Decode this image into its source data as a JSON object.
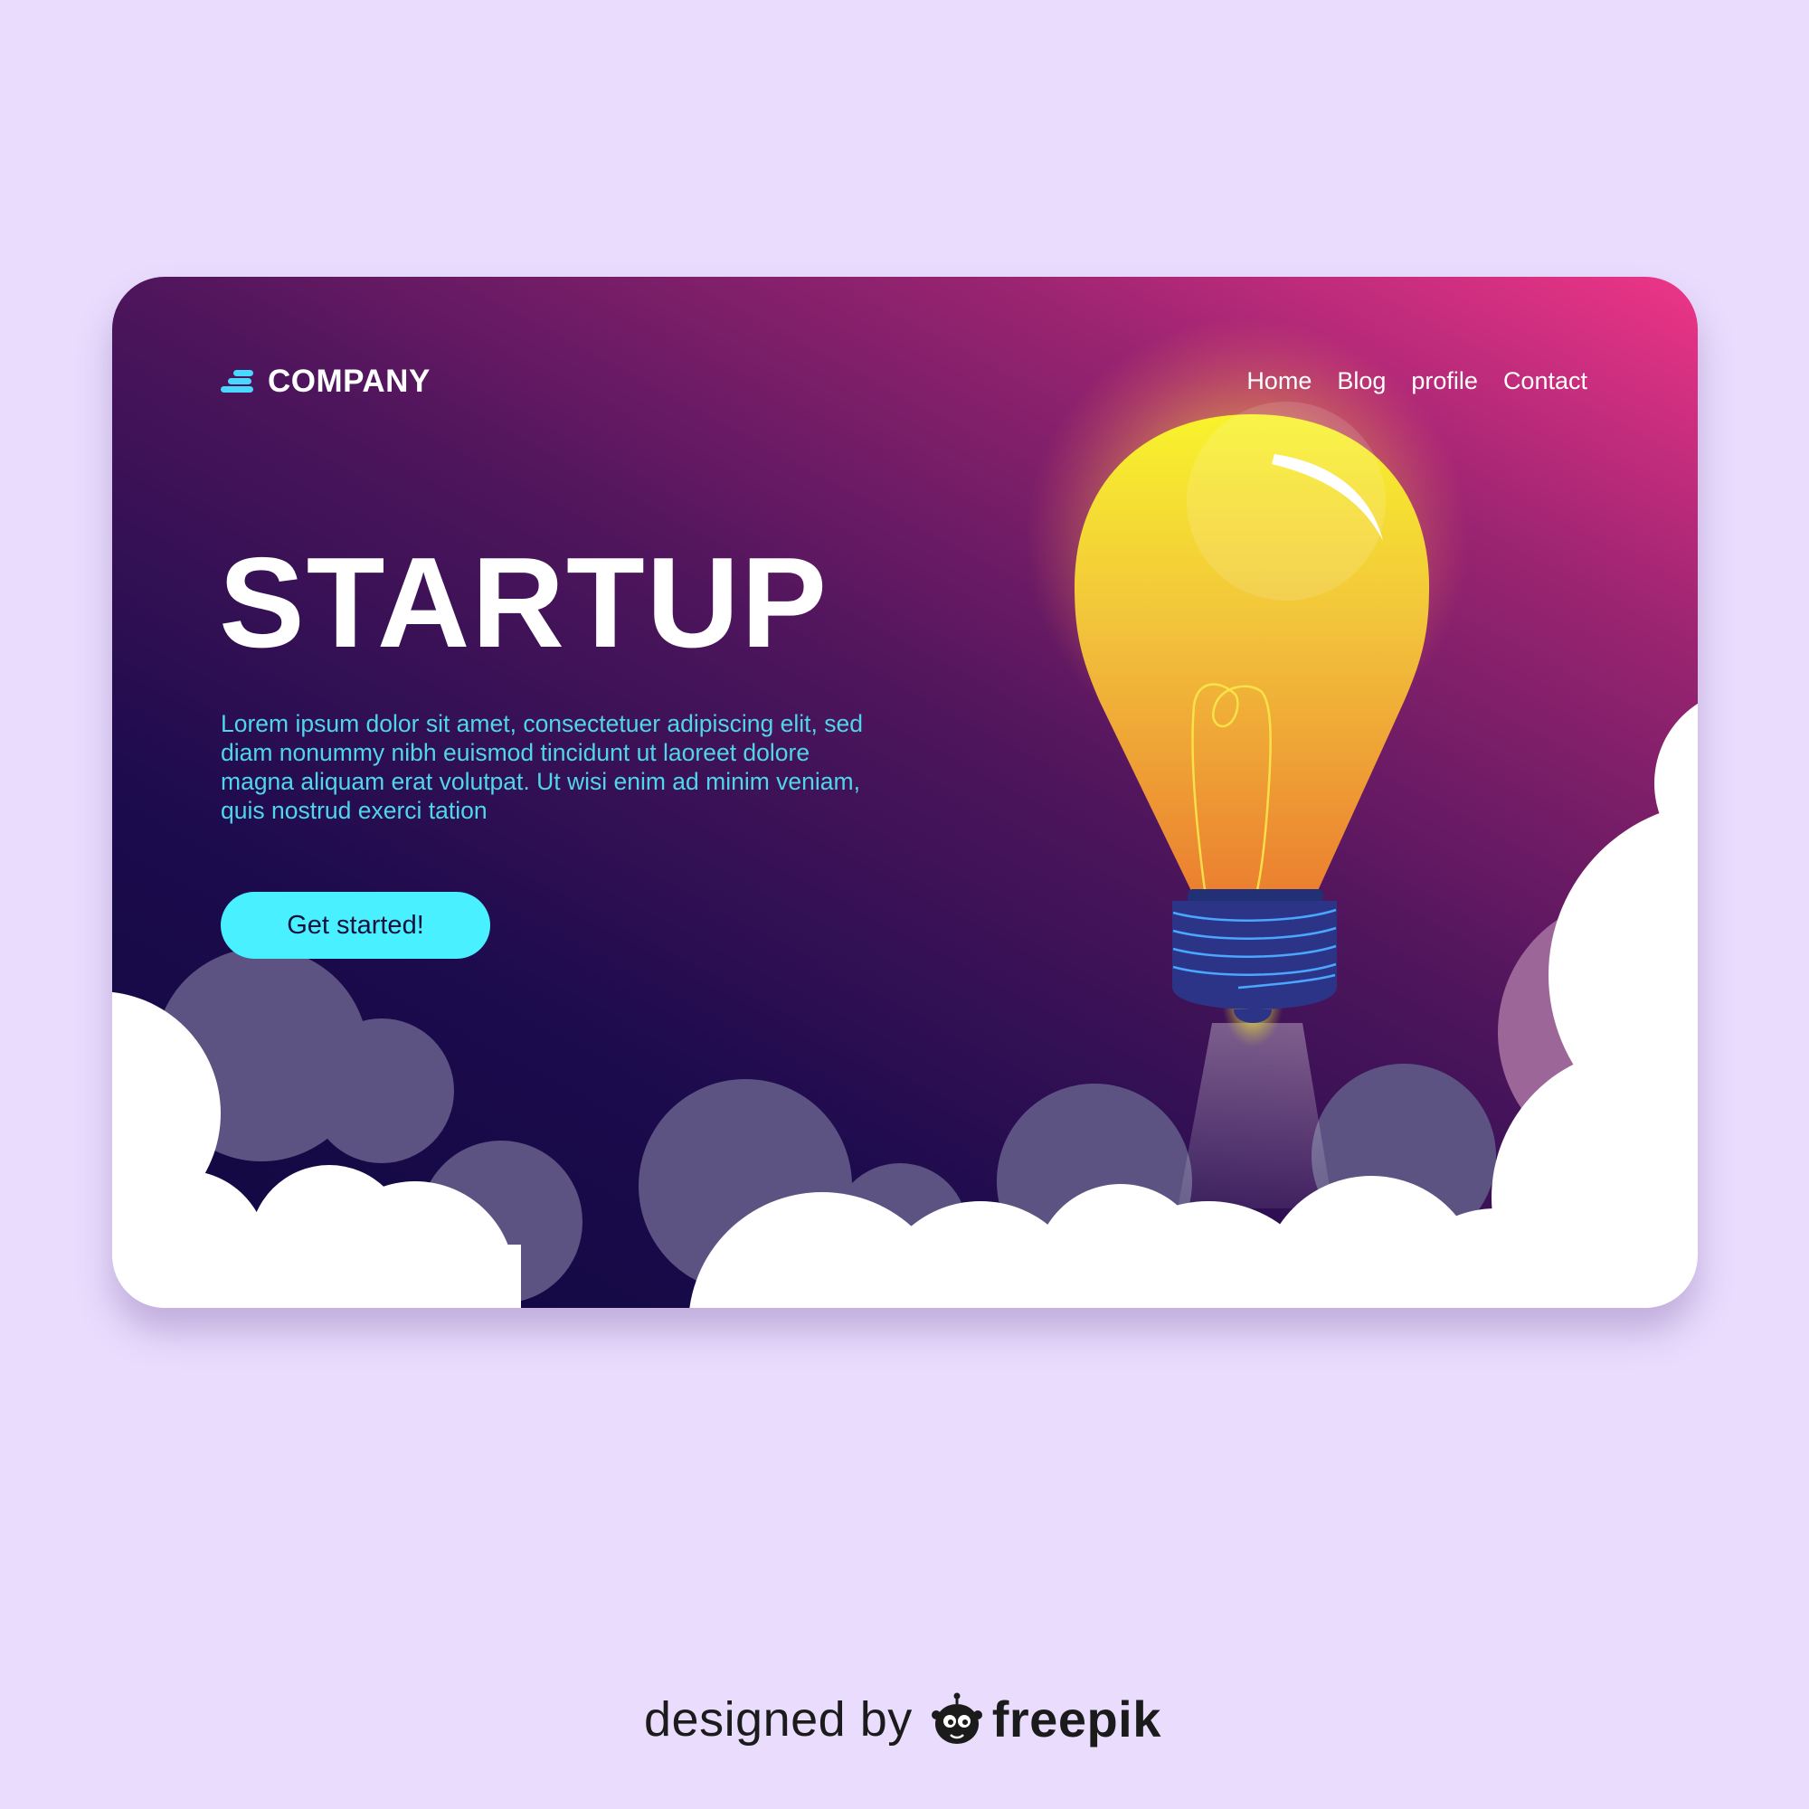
{
  "header": {
    "logo_text": "COMPANY",
    "nav": [
      {
        "label": "Home"
      },
      {
        "label": "Blog"
      },
      {
        "label": "profile"
      },
      {
        "label": "Contact"
      }
    ]
  },
  "hero": {
    "title": "STARTUP",
    "description": "Lorem ipsum dolor sit amet, consectetuer adipiscing elit, sed diam nonummy nibh euismod tincidunt ut laoreet dolore magna aliquam erat volutpat. Ut wisi enim ad minim veniam, quis nostrud exerci tation",
    "cta_label": "Get started!"
  },
  "illustration": {
    "icon": "light-bulb-rocket-icon"
  },
  "footer": {
    "credit_text": "designed by",
    "brand": "freepik",
    "brand_icon": "freepik-logo-icon"
  },
  "colors": {
    "page_background": "#e9dcfd",
    "gradient_start": "#10083f",
    "gradient_end": "#ee3588",
    "accent_cyan": "#49f0ff",
    "description_text": "#4fd6ea",
    "bulb_yellow": "#f7ee2c",
    "bulb_orange": "#ec8a30",
    "bulb_base": "#2c3488",
    "cloud_white": "#ffffff"
  }
}
